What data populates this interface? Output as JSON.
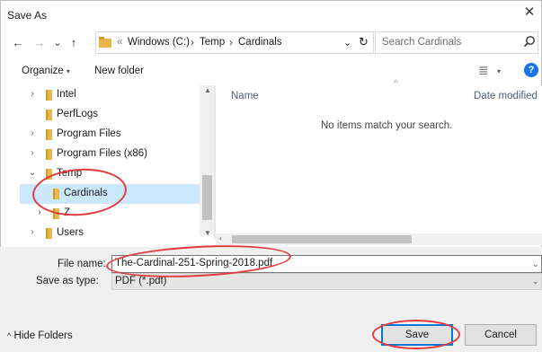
{
  "window": {
    "title": "Save As",
    "close_glyph": "✕"
  },
  "nav": {
    "back_glyph": "←",
    "forward_glyph": "→",
    "recent_glyph": "⌄",
    "up_glyph": "↑",
    "breadcrumb_overflow": "«",
    "breadcrumbs": [
      "Windows (C:)",
      "Temp",
      "Cardinals"
    ],
    "breadcrumb_sep": "›",
    "dropdown_glyph": "⌄",
    "refresh_glyph": "↻",
    "search_placeholder": "Search Cardinals"
  },
  "toolbar": {
    "organize": "Organize",
    "organize_chev": "▾",
    "new_folder": "New folder",
    "view_glyph": "≣",
    "view_chev": "▾",
    "help_glyph": "?"
  },
  "tree": {
    "items": [
      {
        "label": "Intel",
        "expand": "›"
      },
      {
        "label": "PerfLogs",
        "expand": ""
      },
      {
        "label": "Program Files",
        "expand": "›"
      },
      {
        "label": "Program Files (x86)",
        "expand": "›"
      },
      {
        "label": "Temp",
        "expand": "⌄"
      },
      {
        "label": "Cardinals",
        "expand": ""
      },
      {
        "label": "Z",
        "expand": "›"
      },
      {
        "label": "Users",
        "expand": "›"
      }
    ]
  },
  "list": {
    "columns": [
      "Name",
      "Date modified"
    ],
    "sort_glyph": "^",
    "empty_message": "No items match your search."
  },
  "form": {
    "file_name_label": "File name:",
    "file_name_value": "The-Cardinal-251-Spring-2018.pdf",
    "save_type_label": "Save as type:",
    "save_type_value": "PDF (*.pdf)"
  },
  "footer": {
    "hide_folders_glyph": "^",
    "hide_folders": "Hide Folders",
    "save": "Save",
    "cancel": "Cancel"
  },
  "colors": {
    "accent": "#0078d7",
    "selection": "#cce8ff",
    "annotation": "#e23b3b",
    "folder": "#e8b64a"
  }
}
